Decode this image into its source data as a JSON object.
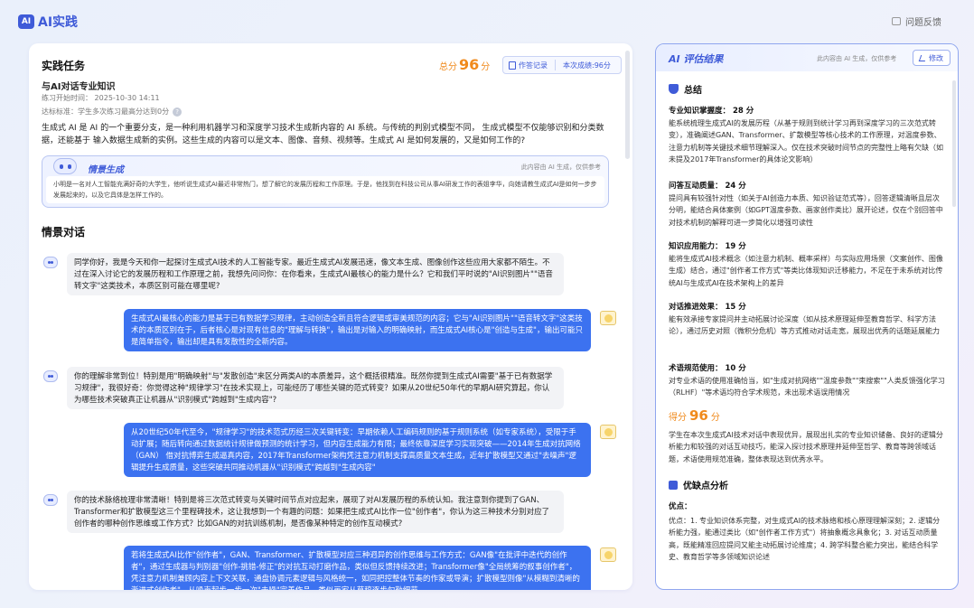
{
  "app": {
    "logo_badge": "AI",
    "logo_text": "AI实践",
    "feedback": "问题反馈"
  },
  "task": {
    "section_title": "实践任务",
    "score_prefix": "总分",
    "score": "96",
    "score_unit": "分",
    "record_label": "作答记录",
    "this_score_label": "本次成绩:96分",
    "name": "与AI对话专业知识",
    "start_time_label": "练习开始时间：",
    "start_time": "2025-10-30 14:11",
    "standard_label": "达标标准：",
    "standard": "学生多次练习最高分达到0分",
    "description": "生成式 AI 是 AI 的一个重要分支，是一种利用机器学习和深度学习技术生成新内容的 AI 系统。与传统的判别式模型不同， 生成式模型不仅能够识别和分类数据，还能基于 输入数据生成新的实例。这些生成的内容可以是文本、图像、音频、视频等。生成式 AI 是如何发展的，又是如何工作的?"
  },
  "scenario": {
    "title": "情景生成",
    "ai_note": "此内容由 AI 生成，仅供参考",
    "text": "小明是一名对人工智能充满好奇的大学生，他听说生成式AI最近非常热门，想了解它的发展历程和工作原理。于是，他找到在科技公司从事AI研发工作的表姐李华，向她请教生成式AI是如何一步步发展起来的，以及它具体是怎样工作的。"
  },
  "dialog": {
    "title": "情景对话",
    "messages": [
      {
        "role": "ai",
        "text": "同学你好，我是今天和你一起探讨生成式AI技术的人工智能专家。最近生成式AI发展迅速，像文本生成、图像创作这些应用大家都不陌生。不过在深入讨论它的发展历程和工作原理之前，我想先问问你：在你看来，生成式AI最核心的能力是什么？它和我们平时说的\"AI识别图片\"\"语音转文字\"这类技术，本质区别可能在哪里呢?"
      },
      {
        "role": "user",
        "text": "生成式AI最核心的能力是基于已有数据学习规律，主动创造全新且符合逻辑或审美规范的内容；它与\"AI识别图片\"\"语音转文字\"这类技术的本质区别在于，后者核心是对现有信息的\"理解与转换\"，输出是对输入的明确映射，而生成式AI核心是\"创造与生成\"，输出可能只是简单指令，输出却是具有发散性的全新内容。"
      },
      {
        "role": "ai",
        "text": "你的理解非常到位！特别是用\"明确映射\"与\"发散创造\"来区分两类AI的本质差异，这个概括很精准。既然你提到生成式AI需要\"基于已有数据学习规律\"，我很好奇：你觉得这种\"规律学习\"在技术实现上，可能经历了哪些关键的范式转变？如果从20世纪50年代的早期AI研究算起，你认为哪些技术突破真正让机器从\"识别模式\"跨越到\"生成内容\"?"
      },
      {
        "role": "user",
        "text": "从20世纪50年代至今，\"规律学习\"的技术范式历经三次关键转变：早期依赖人工编码规则的基于规则系统（如专家系统），受限于手动扩展；随后转向通过数据统计规律做预测的统计学习，但内容生成能力有限；最终依靠深度学习实现突破——2014年生成对抗网络（GAN） 借对抗博弈生成逼真内容，2017年Transformer架构凭注意力机制支撑高质量文本生成，近年扩散模型又通过\"去噪声\"逻辑提升生成质量，这些突破共同推动机器从\"识别模式\"跨越到\"生成内容\""
      },
      {
        "role": "ai",
        "text": "你的技术脉络梳理非常清晰！特别是将三次范式转变与关键时间节点对应起来，展现了对AI发展历程的系统认知。我注意到你提到了GAN、Transformer和扩散模型这三个里程碑技术，这让我想到一个有趣的问题：如果把生成式AI比作一位\"创作者\"，你认为这三种技术分别对应了创作者的哪种创作思维或工作方式？比如GAN的对抗训练机制，是否像某种特定的创作互动模式?"
      },
      {
        "role": "user",
        "text": "若将生成式AI比作\"创作者\"，GAN、Transformer、扩散模型对应三种迥异的创作思维与工作方式：GAN像\"在批评中迭代的创作者\"，通过生成器与判别器\"创作-挑错-修正\"的对抗互动打磨作品，类似但反馈持续改进；Transformer像\"全局统筹的叙事创作者\"，凭注意力机制兼顾内容上下文关联，通盘协调元素逻辑与风格统一，如同把控整体节奏的作家或导演；扩散模型则像\"从模糊到清晰的渐进式创作者\"，从噪声起步一步一次\"去噪\"完善作品，类似画家从草稿逐步勾勒细节"
      }
    ]
  },
  "evaluation": {
    "title": "AI 评估结果",
    "ai_note": "此内容由 AI 生成，仅供参考",
    "edit_label": "修改",
    "summary_title": "总结",
    "items": [
      {
        "title": "专业知识掌握度：  28 分",
        "text": "能系统梳理生成式AI的发展历程（从基于规则到统计学习再到深度学习的三次范式转变），准确阐述GAN、Transformer、扩散模型等核心技术的工作原理，对温度参数、注意力机制等关键技术细节理解深入。仅在技术突破时间节点的完整性上略有欠缺（如未提及2017年Transformer的具体论文影响）"
      },
      {
        "title": "问答互动质量：  24 分",
        "text": "提问具有较强针对性（如关于AI创造力本质、知识验证范式等），回答逻辑清晰且层次分明，能结合具体案例（如GPT温度参数、画家创作类比）展开论述，仅在个别回答中对技术机制的解释可进一步简化以增强可读性"
      },
      {
        "title": "知识应用能力：  19 分",
        "text": "能将生成式AI技术概念（如注意力机制、概率采样）与实际应用场景（文案创作、图像生成）结合，通过\"创作者工作方式\"等类比体现知识迁移能力，不足在于未系统对比传统AI与生成式AI在技术架构上的差异"
      },
      {
        "title": "对话推进效果：  15 分",
        "text": "能有效承接专家提问并主动拓展讨论深度（如从技术原理延伸至教育哲学、科学方法论），通过历史对照（微积分危机）等方式推动对话走宽，展现出优秀的话题延展能力"
      },
      {
        "title": "术语规范使用：  10 分",
        "text": "对专业术语的使用准确恰当，如\"生成对抗网络\"\"温度参数\"\"束搜索\"\"人类反馈强化学习（RLHF）\"等术语均符合学术规范，未出现术语误用情况"
      }
    ],
    "score_prefix": "得分",
    "score": "96",
    "score_unit": "分",
    "overall": "学生在本次生成式AI技术对话中表现优异，展现出扎实的专业知识储备、良好的逻辑分析能力和较强的对话互动技巧，能深入探讨技术原理并延伸至哲学、教育等跨领域话题，术语使用规范准确，整体表现达到优秀水平。",
    "analysis_title": "优缺点分析",
    "strengths_label": "优点：",
    "strengths_text": "优点：1. 专业知识体系完整，对生成式AI的技术脉络和核心原理理解深刻；2. 逻辑分析能力强，能通过类比（如\"创作者工作方式\"）将抽象概念具象化；3. 对话互动质量高，既能精准回应提问又能主动拓展讨论维度；4. 跨学科整合能力突出，能结合科学史、教育哲学等多领域知识论述"
  }
}
